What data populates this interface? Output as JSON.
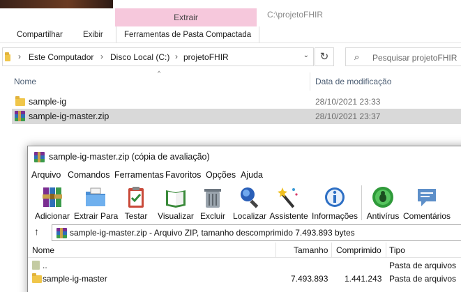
{
  "explorer": {
    "ribbon": {
      "context_tab": "Extrair",
      "window_title": "C:\\projetoFHIR",
      "tabs": [
        {
          "label": "Compartilhar"
        },
        {
          "label": "Exibir"
        },
        {
          "label": "Ferramentas de Pasta Compactada"
        }
      ]
    },
    "breadcrumb": [
      "Este Computador",
      "Disco Local (C:)",
      "projetoFHIR"
    ],
    "search_placeholder": "Pesquisar projetoFHIR",
    "columns": {
      "name": "Nome",
      "date": "Data de modificação"
    },
    "files": [
      {
        "name": "sample-ig",
        "date": "28/10/2021 23:33",
        "icon": "folder-icon",
        "selected": false
      },
      {
        "name": "sample-ig-master.zip",
        "date": "28/10/2021 23:37",
        "icon": "winrar-archive-icon",
        "selected": true
      }
    ]
  },
  "winrar": {
    "title": "sample-ig-master.zip (cópia de avaliação)",
    "menu": [
      "Arquivo",
      "Comandos",
      "Ferramentas",
      "Favoritos",
      "Opções",
      "Ajuda"
    ],
    "toolbar": [
      {
        "label": "Adicionar",
        "icon": "books-stack-icon"
      },
      {
        "label": "Extrair Para",
        "icon": "folder-extract-icon"
      },
      {
        "label": "Testar",
        "icon": "clipboard-check-icon"
      },
      {
        "label": "Visualizar",
        "icon": "book-view-icon"
      },
      {
        "label": "Excluir",
        "icon": "trash-icon"
      },
      {
        "label": "Localizar",
        "icon": "magnifier-icon"
      },
      {
        "label": "Assistente",
        "icon": "magic-wand-icon"
      },
      {
        "label": "Informações",
        "icon": "info-icon"
      },
      {
        "label": "Antivírus",
        "icon": "bug-icon"
      },
      {
        "label": "Comentários",
        "icon": "speech-bubble-icon"
      }
    ],
    "path_text": "sample-ig-master.zip - Arquivo ZIP, tamanho descomprimido 7.493.893 bytes",
    "columns": {
      "name": "Nome",
      "size": "Tamanho",
      "packed": "Comprimido",
      "type": "Tipo"
    },
    "rows": [
      {
        "name": "..",
        "size": "",
        "packed": "",
        "type": "Pasta de arquivos"
      },
      {
        "name": "sample-ig-master",
        "size": "7.493.893",
        "packed": "1.441.243",
        "type": "Pasta de arquivos"
      }
    ]
  }
}
